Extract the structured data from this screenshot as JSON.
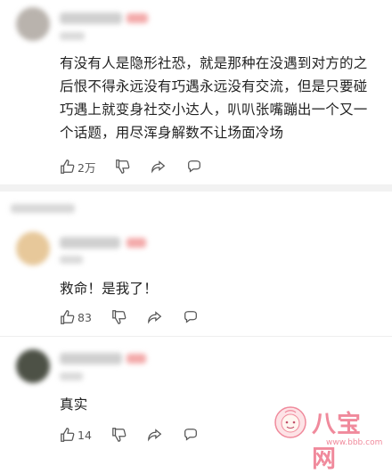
{
  "comments": [
    {
      "text": "有没有人是隐形社恐，就是那种在没遇到对方的之后恨不得永远没有巧遇永远没有交流，但是只要碰巧遇上就变身社交小达人，叭叭张嘴蹦出一个又一个话题，用尽浑身解数不让场面冷场",
      "likes": "2万"
    },
    {
      "text": "救命！是我了！",
      "likes": "83"
    },
    {
      "text": "真实",
      "likes": "14"
    }
  ],
  "watermark": {
    "brand": "八宝网",
    "url": "www.bbb.com"
  },
  "colors": {
    "badge": "#f3a9a9",
    "watermark_pink": "#f08a9c"
  },
  "icons": [
    "thumb-up-icon",
    "thumb-down-icon",
    "share-icon",
    "comment-icon"
  ]
}
